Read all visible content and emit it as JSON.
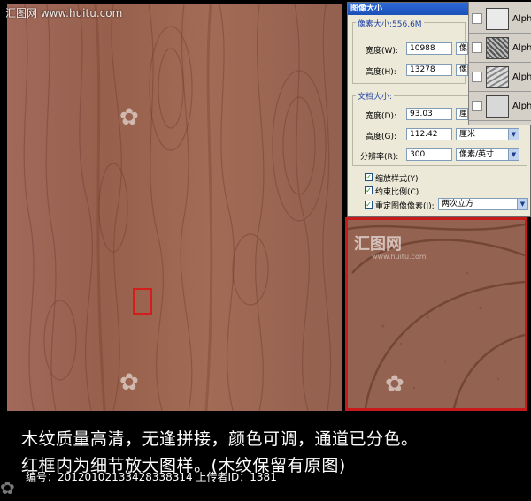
{
  "watermark": {
    "site_text": "汇图网 www.huitu.com",
    "logo_text": "汇图网",
    "logo_sub": "www.huitu.com"
  },
  "dialog": {
    "title": "图像大小",
    "pixel_size_label": "像素大小:556.6M",
    "pixel": {
      "width_label": "宽度(W):",
      "width_value": "10988",
      "width_unit": "像素",
      "height_label": "高度(H):",
      "height_value": "13278",
      "height_unit": "像素"
    },
    "doc_size_label": "文档大小:",
    "doc": {
      "width_label": "宽度(D):",
      "width_value": "93.03",
      "width_unit": "厘米",
      "height_label": "高度(G):",
      "height_value": "112.42",
      "height_unit": "厘米",
      "res_label": "分辨率(R):",
      "res_value": "300",
      "res_unit": "像素/英寸"
    },
    "checkboxes": [
      {
        "label": "缩放样式(Y)",
        "checked": true
      },
      {
        "label": "约束比例(C)",
        "checked": true
      },
      {
        "label": "重定图像像素(I):",
        "checked": true
      }
    ],
    "resample_value": "两次立方"
  },
  "channels": [
    {
      "name": "Alph"
    },
    {
      "name": "Alph"
    },
    {
      "name": "Alph"
    },
    {
      "name": "Alph"
    }
  ],
  "captions": {
    "line1": "木纹质量高清，无逢拼接，颜色可调，通道已分色。",
    "line2": "红框内为细节放大图样。(木纹保留有原图)",
    "id_line": "编号：20120102133428338314 上传者ID：1381"
  },
  "colors": {
    "wood": "#9b6550",
    "red_frame": "#c81a1a",
    "titlebar": "#2e6bd8",
    "dialog_bg": "#ece9d8"
  }
}
